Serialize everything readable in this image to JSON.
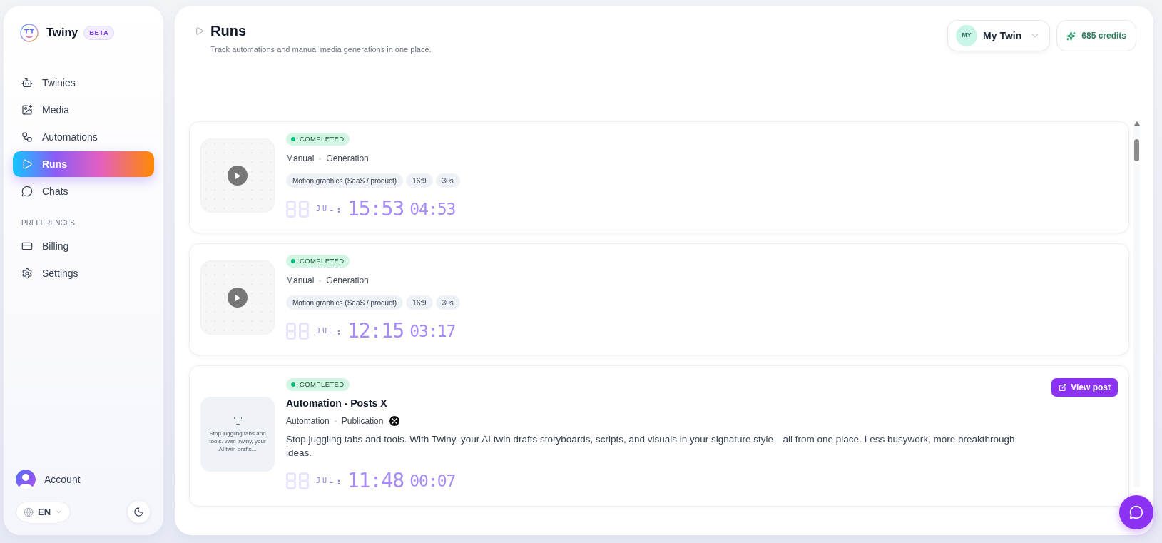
{
  "sidebar": {
    "brand": {
      "name": "Twiny",
      "badge": "BETA"
    },
    "nav": [
      {
        "label": "Twinies",
        "selected": false
      },
      {
        "label": "Media",
        "selected": false
      },
      {
        "label": "Automations",
        "selected": false
      },
      {
        "label": "Runs",
        "selected": true
      },
      {
        "label": "Chats",
        "selected": false
      }
    ],
    "section_label": "PREFERENCES",
    "preferences": [
      {
        "label": "Billing",
        "selected": false
      },
      {
        "label": "Settings",
        "selected": false
      }
    ],
    "account": {
      "label": "Account"
    },
    "language": {
      "code": "EN"
    }
  },
  "header": {
    "title": "Runs",
    "subtitle": "Track automations and manual media generations in one place.",
    "twin": {
      "initials": "MY",
      "name": "My Twin"
    },
    "credits": "685 credits"
  },
  "runs": [
    {
      "kind": "video",
      "status": "COMPLETED",
      "meta": [
        "Manual",
        "Generation"
      ],
      "tags": [
        "Motion graphics (SaaS / product)",
        "16:9",
        "30s"
      ],
      "month": "JUL",
      "separator": ":",
      "time": "15:53",
      "duration": "04:53"
    },
    {
      "kind": "video",
      "status": "COMPLETED",
      "meta": [
        "Manual",
        "Generation"
      ],
      "tags": [
        "Motion graphics (SaaS / product)",
        "16:9",
        "30s"
      ],
      "month": "JUL",
      "separator": ":",
      "time": "12:15",
      "duration": "03:17"
    },
    {
      "kind": "post",
      "status": "COMPLETED",
      "action": "View post",
      "preview": "Stop juggling tabs and tools. With Twiny, your AI twin drafts...",
      "title": "Automation - Posts X",
      "meta": [
        "Automation",
        "Publication"
      ],
      "description": "Stop juggling tabs and tools. With Twiny, your AI twin drafts storyboards, scripts, and visuals in your signature style—all from one place. Less busywork, more breakthrough ideas.",
      "month": "JUL",
      "separator": ":",
      "time": "11:48",
      "duration": "00:07"
    }
  ]
}
